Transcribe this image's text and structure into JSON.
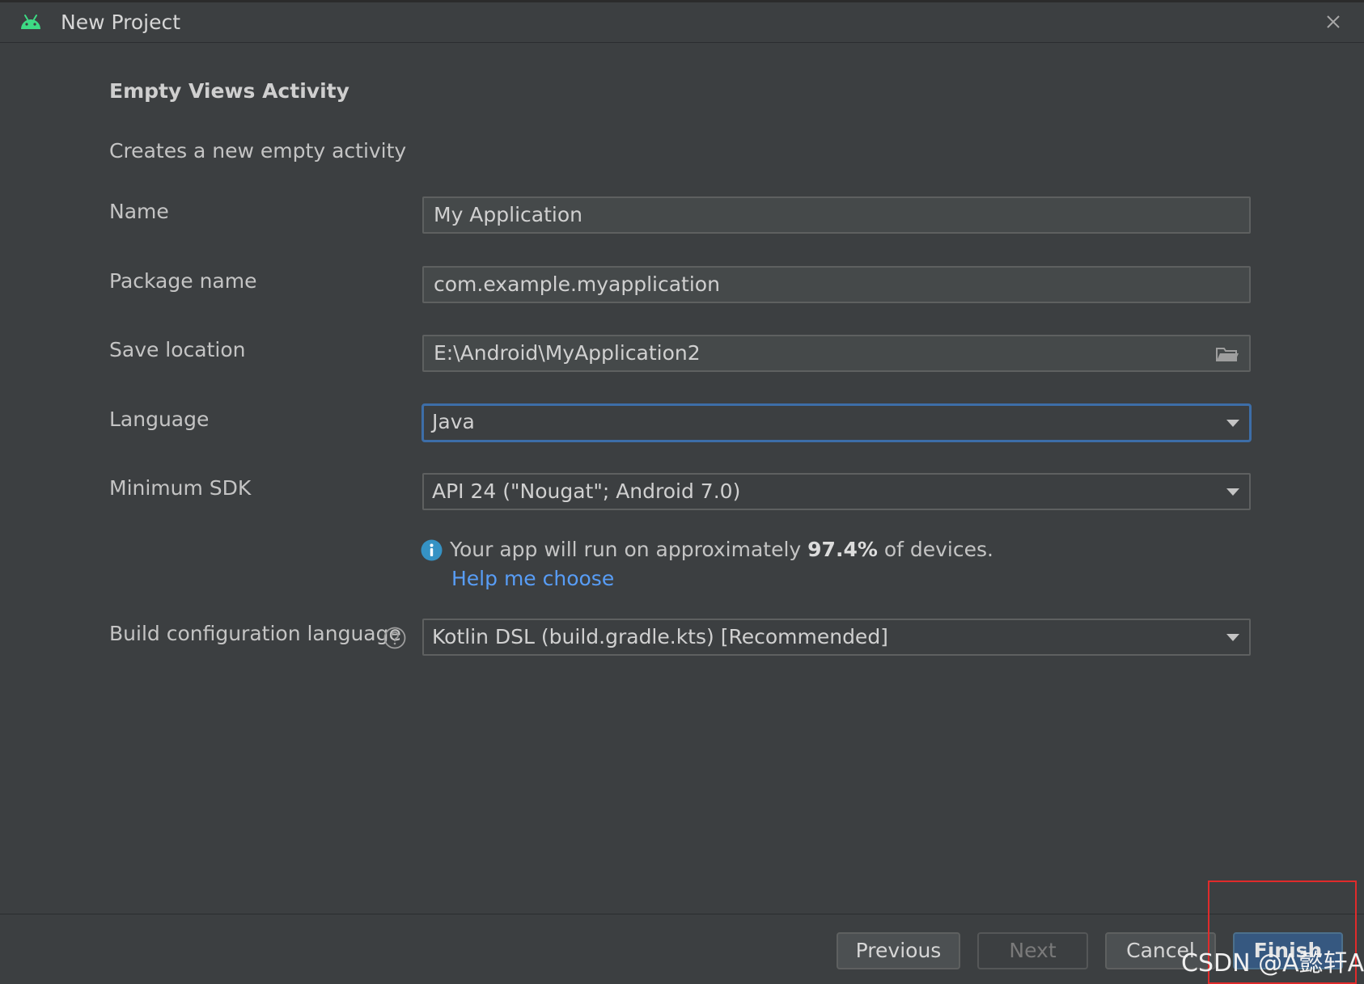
{
  "window": {
    "title": "New Project"
  },
  "template": {
    "heading": "Empty Views Activity",
    "description": "Creates a new empty activity"
  },
  "form": {
    "name": {
      "label": "Name",
      "value": "My Application"
    },
    "package_name": {
      "label": "Package name",
      "value": "com.example.myapplication"
    },
    "save_location": {
      "label": "Save location",
      "value": "E:\\Android\\MyApplication2"
    },
    "language": {
      "label": "Language",
      "value": "Java"
    },
    "minimum_sdk": {
      "label": "Minimum SDK",
      "value": "API 24 (\"Nougat\"; Android 7.0)"
    },
    "sdk_info": {
      "prefix": "Your app will run on approximately ",
      "percent": "97.4%",
      "suffix": " of devices.",
      "help_link": "Help me choose"
    },
    "build_config": {
      "label": "Build configuration language",
      "value": "Kotlin DSL (build.gradle.kts) [Recommended]"
    }
  },
  "footer": {
    "previous": "Previous",
    "next": "Next",
    "cancel": "Cancel",
    "finish": "Finish"
  },
  "overlay": {
    "watermark": "CSDN @A懿轩A"
  },
  "colors": {
    "background": "#3c3f41",
    "field": "#45494a",
    "focus_border": "#3d6ea8",
    "link": "#589df6",
    "info_icon": "#3592c4",
    "android_green": "#3ddc84",
    "primary_button": "#365880",
    "highlight": "#e02b2b"
  },
  "icons": {
    "app": "android-icon",
    "close": "close-icon",
    "browse": "folder-icon",
    "info": "info-icon",
    "help": "question-icon",
    "dropdown": "chevron-down-icon"
  }
}
